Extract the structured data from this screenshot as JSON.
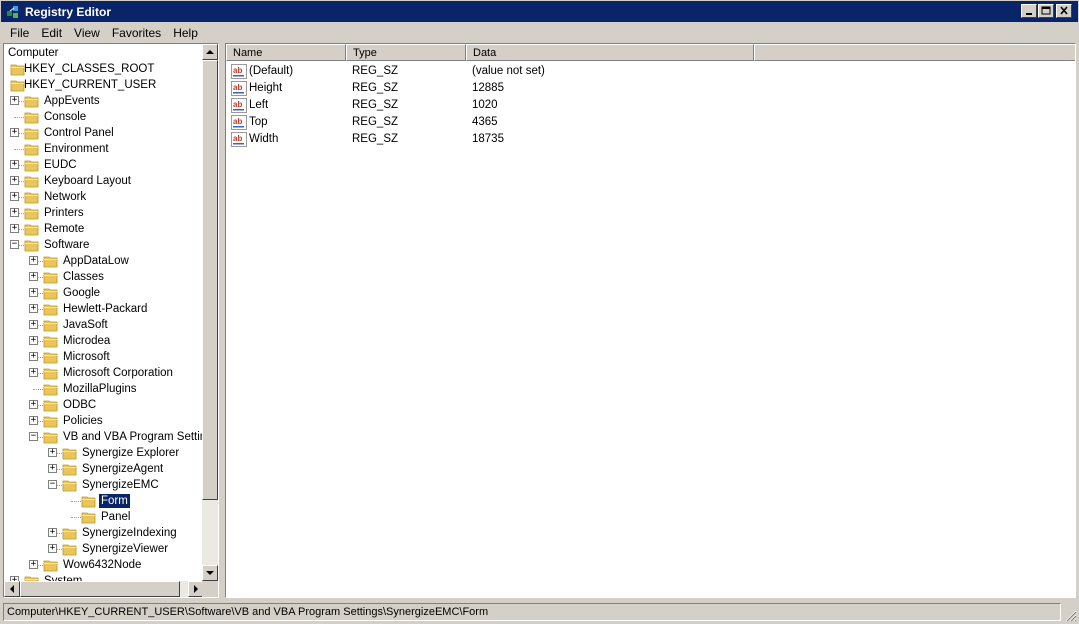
{
  "window": {
    "title": "Registry Editor",
    "controls": [
      "minimize",
      "maximize",
      "close"
    ]
  },
  "menu": [
    "File",
    "Edit",
    "View",
    "Favorites",
    "Help"
  ],
  "tree": [
    {
      "label": "Computer",
      "level": 0,
      "expander": "none",
      "folder": false
    },
    {
      "label": "HKEY_CLASSES_ROOT",
      "level": 0,
      "expander": "none",
      "folder": true
    },
    {
      "label": "HKEY_CURRENT_USER",
      "level": 0,
      "expander": "none",
      "folder": true
    },
    {
      "label": "AppEvents",
      "level": 1,
      "expander": "plus",
      "folder": true
    },
    {
      "label": "Console",
      "level": 1,
      "expander": "none",
      "folder": true
    },
    {
      "label": "Control Panel",
      "level": 1,
      "expander": "plus",
      "folder": true
    },
    {
      "label": "Environment",
      "level": 1,
      "expander": "none",
      "folder": true
    },
    {
      "label": "EUDC",
      "level": 1,
      "expander": "plus",
      "folder": true
    },
    {
      "label": "Keyboard Layout",
      "level": 1,
      "expander": "plus",
      "folder": true
    },
    {
      "label": "Network",
      "level": 1,
      "expander": "plus",
      "folder": true
    },
    {
      "label": "Printers",
      "level": 1,
      "expander": "plus",
      "folder": true
    },
    {
      "label": "Remote",
      "level": 1,
      "expander": "plus",
      "folder": true
    },
    {
      "label": "Software",
      "level": 1,
      "expander": "minus",
      "folder": true
    },
    {
      "label": "AppDataLow",
      "level": 2,
      "expander": "plus",
      "folder": true
    },
    {
      "label": "Classes",
      "level": 2,
      "expander": "plus",
      "folder": true
    },
    {
      "label": "Google",
      "level": 2,
      "expander": "plus",
      "folder": true
    },
    {
      "label": "Hewlett-Packard",
      "level": 2,
      "expander": "plus",
      "folder": true
    },
    {
      "label": "JavaSoft",
      "level": 2,
      "expander": "plus",
      "folder": true
    },
    {
      "label": "Microdea",
      "level": 2,
      "expander": "plus",
      "folder": true
    },
    {
      "label": "Microsoft",
      "level": 2,
      "expander": "plus",
      "folder": true
    },
    {
      "label": "Microsoft Corporation",
      "level": 2,
      "expander": "plus",
      "folder": true
    },
    {
      "label": "MozillaPlugins",
      "level": 2,
      "expander": "none",
      "folder": true
    },
    {
      "label": "ODBC",
      "level": 2,
      "expander": "plus",
      "folder": true
    },
    {
      "label": "Policies",
      "level": 2,
      "expander": "plus",
      "folder": true
    },
    {
      "label": "VB and VBA Program Settings",
      "level": 2,
      "expander": "minus",
      "folder": true
    },
    {
      "label": "Synergize Explorer",
      "level": 3,
      "expander": "plus",
      "folder": true
    },
    {
      "label": "SynergizeAgent",
      "level": 3,
      "expander": "plus",
      "folder": true
    },
    {
      "label": "SynergizeEMC",
      "level": 3,
      "expander": "minus",
      "folder": true
    },
    {
      "label": "Form",
      "level": 4,
      "expander": "none",
      "folder": true,
      "selected": true
    },
    {
      "label": "Panel",
      "level": 4,
      "expander": "none",
      "folder": true
    },
    {
      "label": "SynergizeIndexing",
      "level": 3,
      "expander": "plus",
      "folder": true
    },
    {
      "label": "SynergizeViewer",
      "level": 3,
      "expander": "plus",
      "folder": true
    },
    {
      "label": "Wow6432Node",
      "level": 2,
      "expander": "plus",
      "folder": true
    },
    {
      "label": "System",
      "level": 1,
      "expander": "plus",
      "folder": true
    }
  ],
  "list": {
    "columns": [
      "Name",
      "Type",
      "Data"
    ],
    "rows": [
      {
        "name": "(Default)",
        "type": "REG_SZ",
        "data": "(value not set)",
        "icon": "string-value-icon"
      },
      {
        "name": "Height",
        "type": "REG_SZ",
        "data": "12885",
        "icon": "string-value-icon"
      },
      {
        "name": "Left",
        "type": "REG_SZ",
        "data": "1020",
        "icon": "string-value-icon"
      },
      {
        "name": "Top",
        "type": "REG_SZ",
        "data": "4365",
        "icon": "string-value-icon"
      },
      {
        "name": "Width",
        "type": "REG_SZ",
        "data": "18735",
        "icon": "string-value-icon"
      }
    ]
  },
  "status": {
    "path": "Computer\\HKEY_CURRENT_USER\\Software\\VB and VBA Program Settings\\SynergizeEMC\\Form"
  },
  "colors": {
    "titlebar": "#0a246a",
    "selection": "#0a246a",
    "folder": "#e8c65a",
    "ab_icon_red": "#c0392b"
  }
}
